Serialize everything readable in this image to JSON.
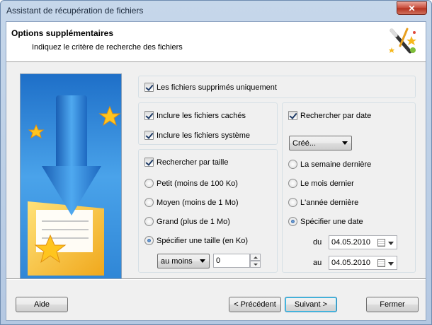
{
  "window": {
    "title": "Assistant de récupération de fichiers",
    "close_glyph": "✕"
  },
  "header": {
    "title": "Options supplémentaires",
    "subtitle": "Indiquez le critère de recherche des fichiers",
    "icon": "magic-wand-icon"
  },
  "side_image": {
    "icon": "floppy-disk-download-with-stars"
  },
  "options": {
    "deleted_only": {
      "label": "Les fichiers supprimés uniquement",
      "checked": true
    },
    "hidden_files": {
      "label": "Inclure les fichiers cachés",
      "checked": true
    },
    "system_files": {
      "label": "Inclure les fichiers système",
      "checked": true
    }
  },
  "size": {
    "enable": {
      "label": "Rechercher par taille",
      "checked": true
    },
    "radios": [
      {
        "label": "Petit (moins de 100 Ko)",
        "selected": false
      },
      {
        "label": "Moyen (moins de 1 Mo)",
        "selected": false
      },
      {
        "label": "Grand (plus de 1 Mo)",
        "selected": false
      },
      {
        "label": "Spécifier une taille (en Ko)",
        "selected": true
      }
    ],
    "comparator": "au moins",
    "value": "0"
  },
  "date": {
    "enable": {
      "label": "Rechercher par date",
      "checked": true
    },
    "type": "Créé...",
    "radios": [
      {
        "label": "La semaine dernière",
        "selected": false
      },
      {
        "label": "Le mois dernier",
        "selected": false
      },
      {
        "label": "L'année dernière",
        "selected": false
      },
      {
        "label": "Spécifier une date",
        "selected": true
      }
    ],
    "from_label": "du",
    "from_value": "04.05.2010",
    "to_label": "au",
    "to_value": "04.05.2010"
  },
  "buttons": {
    "help": "Aide",
    "back": "< Précédent",
    "next": "Suivant >",
    "close": "Fermer"
  }
}
